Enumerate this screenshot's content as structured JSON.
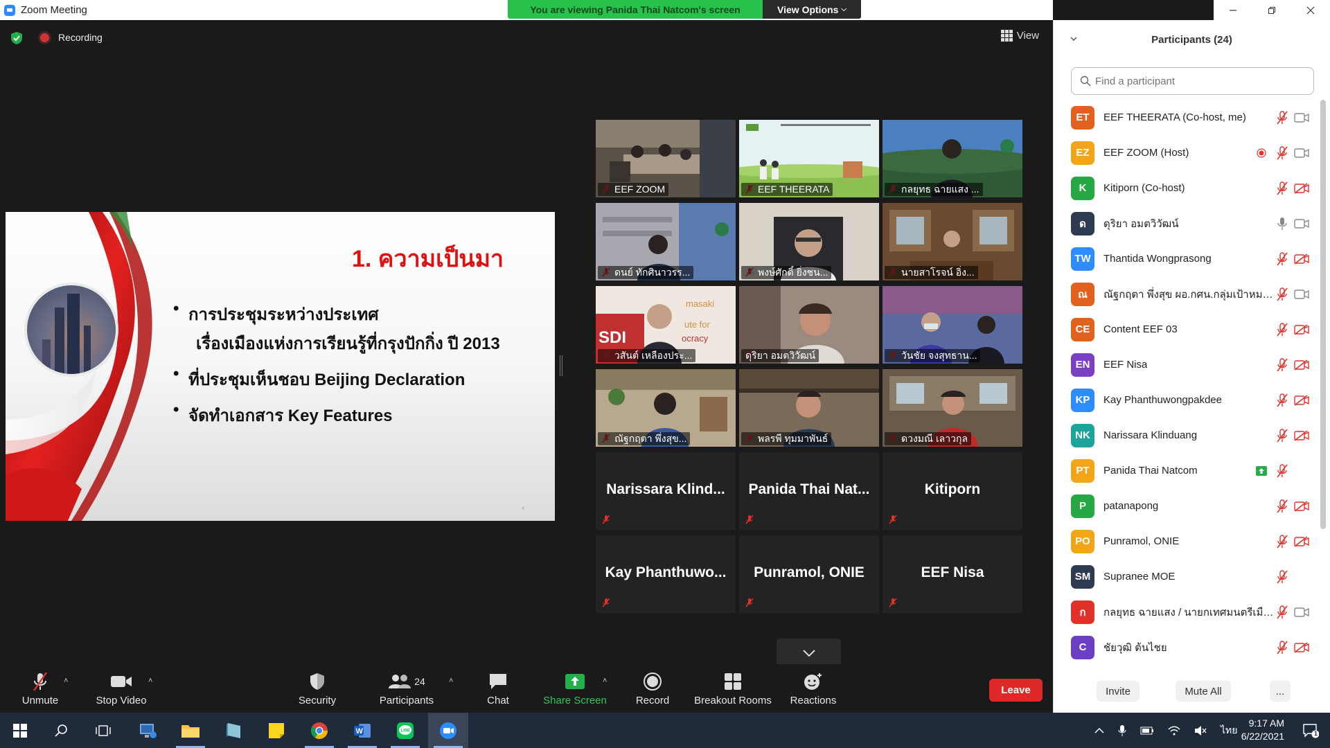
{
  "window": {
    "title": "Zoom Meeting",
    "banner_text": "You are viewing Panida Thai Natcom's screen",
    "view_options": "View Options"
  },
  "status": {
    "recording": "Recording",
    "view": "View"
  },
  "slide": {
    "heading": "1. ความเป็นมา",
    "bullets": [
      "การประชุมระหว่างประเทศ",
      "เรื่องเมืองแห่งการเรียนรู้ที่กรุงปักกิ่ง ปี 2013",
      "ที่ประชุมเห็นชอบ Beijing Declaration",
      "จัดทำเอกสาร Key Features"
    ],
    "page_mark": "4"
  },
  "video_tiles": [
    {
      "name": "EEF ZOOM"
    },
    {
      "name": "EEF THEERATA"
    },
    {
      "name": "กลยุทธ ฉายแสง ..."
    },
    {
      "name": "ดนย์ ทักศินาวรร..."
    },
    {
      "name": "พงษ์ศักดิ์ ยิ่งชน..."
    },
    {
      "name": "นายสาโรจน์ อิ่ง..."
    },
    {
      "name": "วสันต์ เหลืองประ..."
    },
    {
      "name": "ดุริยา อมตวิวัฒน์"
    },
    {
      "name": "วันชัย จงสุทธาน..."
    },
    {
      "name": "ณัฐกฤตา พึ่งสุข..."
    },
    {
      "name": "พลรพี ทุมมาพันธ์"
    },
    {
      "name": "ดวงมณี เลาวกุล"
    }
  ],
  "avatar_tiles": [
    {
      "name": "Narissara  Klind..."
    },
    {
      "name": "Panida  Thai  Nat..."
    },
    {
      "name": "Kitiporn"
    },
    {
      "name": "Kay  Phanthuwo..."
    },
    {
      "name": "Punramol, ONIE"
    },
    {
      "name": "EEF Nisa"
    }
  ],
  "toolbar": {
    "unmute": "Unmute",
    "stop_video": "Stop Video",
    "security": "Security",
    "participants": "Participants",
    "participants_count": "24",
    "chat": "Chat",
    "share_screen": "Share Screen",
    "record": "Record",
    "breakout_rooms": "Breakout Rooms",
    "reactions": "Reactions",
    "leave": "Leave"
  },
  "panel": {
    "title": "Participants (24)",
    "search_placeholder": "Find a participant",
    "invite": "Invite",
    "mute_all": "Mute All",
    "more": "...",
    "participants": [
      {
        "initials": "ET",
        "name": "EEF THEERATA (Co-host, me)",
        "color": "#e0621e",
        "mic": "muted",
        "video": "on"
      },
      {
        "initials": "EZ",
        "name": "EEF ZOOM (Host)",
        "color": "#f2a516",
        "mic": "muted",
        "video": "on",
        "recording": true
      },
      {
        "initials": "K",
        "name": "Kitiporn (Co-host)",
        "color": "#27a844",
        "mic": "muted",
        "video": "off"
      },
      {
        "initials": "ด",
        "name": "ดุริยา อมตวิวัฒน์",
        "color": "#2e3a4f",
        "mic": "on",
        "video": "on"
      },
      {
        "initials": "TW",
        "name": "Thantida Wongprasong",
        "color": "#2d8cff",
        "mic": "muted",
        "video": "off"
      },
      {
        "initials": "ณ",
        "name": "ณัฐกฤตา พึ่งสุข ผอ.กศน.กลุ่มเป้าหมาย...",
        "color": "#e0621e",
        "mic": "muted",
        "video": "on"
      },
      {
        "initials": "CE",
        "name": "Content EEF 03",
        "color": "#e0621e",
        "mic": "muted",
        "video": "off"
      },
      {
        "initials": "EN",
        "name": "EEF Nisa",
        "color": "#7b3fc4",
        "mic": "muted",
        "video": "off"
      },
      {
        "initials": "KP",
        "name": "Kay Phanthuwongpakdee",
        "color": "#2d8cff",
        "mic": "muted",
        "video": "off"
      },
      {
        "initials": "NK",
        "name": "Narissara Klinduang",
        "color": "#1ba39c",
        "mic": "muted",
        "video": "off"
      },
      {
        "initials": "PT",
        "name": "Panida Thai Natcom",
        "color": "#f2a516",
        "mic": "muted",
        "video": "none",
        "sharing": true
      },
      {
        "initials": "P",
        "name": "patanapong",
        "color": "#27a844",
        "mic": "muted",
        "video": "off"
      },
      {
        "initials": "PO",
        "name": "Punramol, ONIE",
        "color": "#f2a516",
        "mic": "muted",
        "video": "off"
      },
      {
        "initials": "SM",
        "name": "Supranee MOE",
        "color": "#2e3a4f",
        "mic": "muted",
        "video": "none"
      },
      {
        "initials": "ก",
        "name": "กลยุทธ ฉายแสง / นายกเทศมนตรีเมือง...",
        "color": "#e0312b",
        "mic": "muted",
        "video": "on"
      },
      {
        "initials": "C",
        "name": "ชัยวุฒิ ต้นไชย",
        "color": "#6b3fc4",
        "mic": "muted",
        "video": "off"
      }
    ]
  },
  "taskbar": {
    "clock_time": "9:17 AM",
    "clock_date": "6/22/2021",
    "language": "ไทย",
    "notifications": "1"
  },
  "colors": {
    "accent_green": "#33c45a",
    "leave_red": "#e02828",
    "muted_red": "#e0312b"
  }
}
